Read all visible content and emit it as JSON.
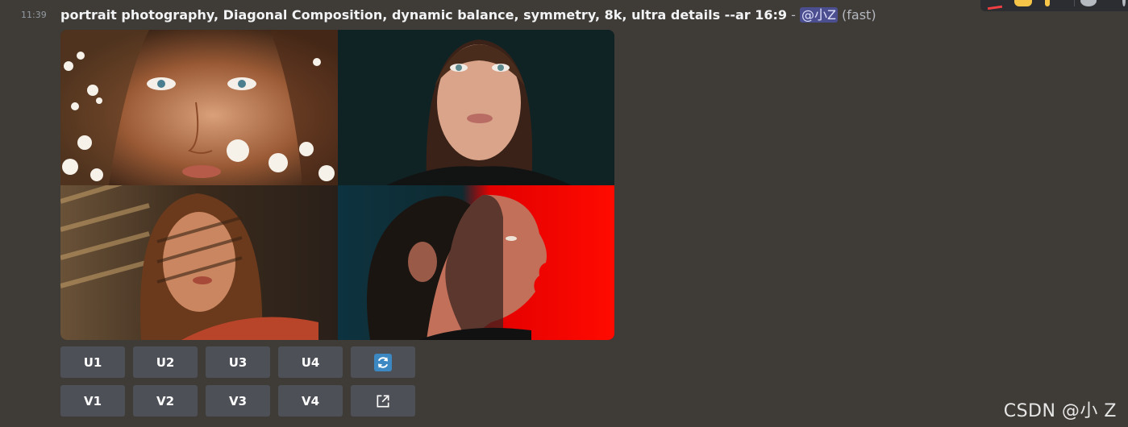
{
  "message": {
    "timestamp": "11:39",
    "prompt": "portrait photography, Diagonal Composition, dynamic balance, symmetry, 8k, ultra details --ar 16:9",
    "separator": " - ",
    "mention": "@小Z",
    "speed": "(fast)"
  },
  "image_grid": {
    "tiles": [
      {
        "name": "portrait-1-blossoms"
      },
      {
        "name": "portrait-2-dark-teal"
      },
      {
        "name": "portrait-3-window-light"
      },
      {
        "name": "portrait-4-red-profile"
      }
    ]
  },
  "buttons": {
    "upscale": [
      "U1",
      "U2",
      "U3",
      "U4"
    ],
    "variation": [
      "V1",
      "V2",
      "V3",
      "V4"
    ],
    "reroll_icon": "refresh-icon",
    "web_icon": "external-link-icon"
  },
  "watermark": "CSDN @小 Z",
  "colors": {
    "background": "#3f3b36",
    "button": "#4e5058",
    "mention_bg": "#4c4f8f",
    "reroll_blue": "#3b88c3"
  }
}
